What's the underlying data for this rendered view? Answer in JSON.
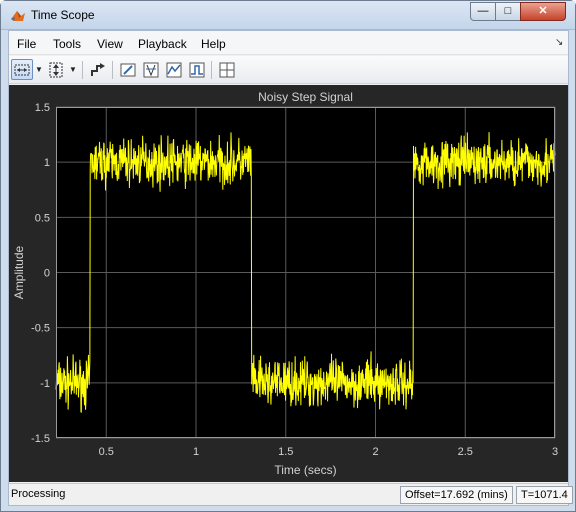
{
  "window": {
    "title": "Time Scope",
    "minimize_glyph": "—",
    "maximize_glyph": "□",
    "close_glyph": "✕"
  },
  "menu": {
    "items": [
      "File",
      "Tools",
      "View",
      "Playback",
      "Help"
    ],
    "dock_glyph": "↘"
  },
  "toolbar": {
    "buttons": [
      "zoom-x-icon",
      "fit-axes-icon",
      "step-forward-icon",
      "signal-properties-icon",
      "cursor-measurements-icon",
      "peak-finder-icon",
      "bilevel-measurements-icon",
      "layout-icon"
    ]
  },
  "colors": {
    "plot_background": "#000000",
    "panel_background": "#262626",
    "grid": "#5a5a5a",
    "axis_text": "#d2d2d2",
    "signal": "#ffff00"
  },
  "chart_data": {
    "type": "line",
    "title": "Noisy Step Signal",
    "xlabel": "Time (secs)",
    "ylabel": "Amplitude",
    "xlim": [
      0.22,
      3.0
    ],
    "ylim": [
      -1.5,
      1.5
    ],
    "x_ticks": [
      0.5,
      1,
      1.5,
      2,
      2.5,
      3
    ],
    "x_tick_labels": [
      "0.5",
      "1",
      "1.5",
      "2",
      "2.5",
      "3"
    ],
    "y_ticks": [
      -1.5,
      -1,
      -0.5,
      0,
      0.5,
      1,
      1.5
    ],
    "y_tick_labels": [
      "-1.5",
      "-1",
      "-0.5",
      "0",
      "0.5",
      "1",
      "1.5"
    ],
    "grid": true,
    "noise_amplitude": 0.13,
    "series": [
      {
        "levels": [
          {
            "x_start": 0.22,
            "x_end": 0.41,
            "y": -1
          },
          {
            "x_start": 0.41,
            "x_end": 1.31,
            "y": 1
          },
          {
            "x_start": 1.31,
            "x_end": 2.21,
            "y": -1
          },
          {
            "x_start": 2.21,
            "x_end": 3.0,
            "y": 1
          }
        ]
      }
    ]
  },
  "status": {
    "text": "Processing",
    "offset": "Offset=17.692 (mins)",
    "time": "T=1071.4"
  }
}
